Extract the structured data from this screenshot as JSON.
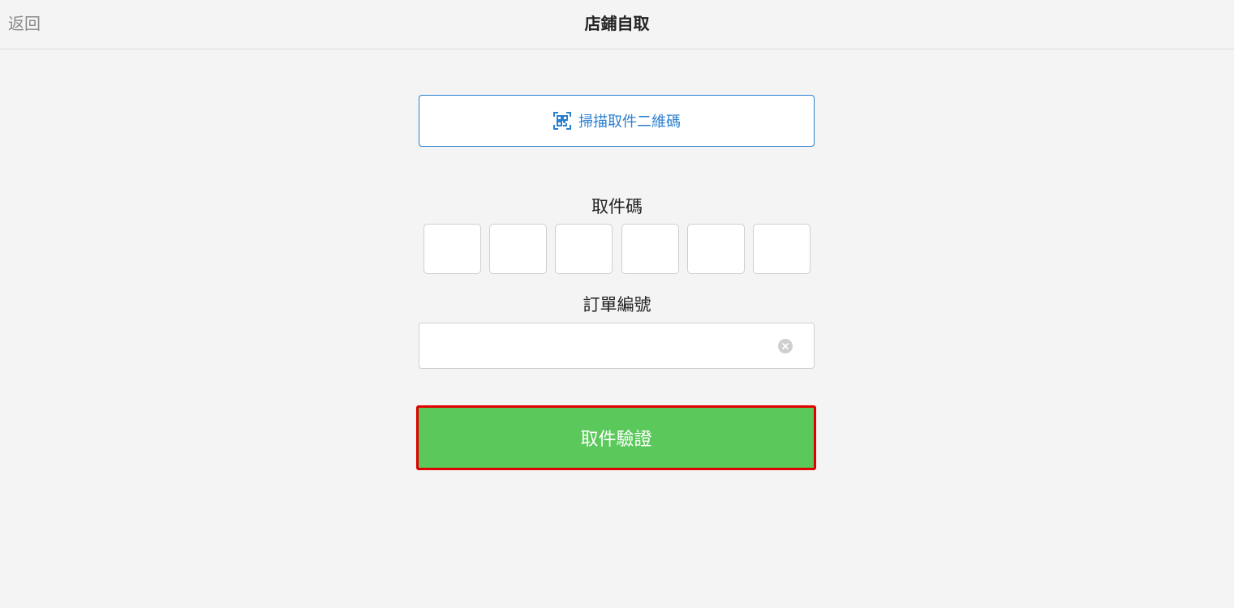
{
  "header": {
    "back_label": "返回",
    "title": "店鋪自取"
  },
  "scan": {
    "label": "掃描取件二維碼",
    "icon": "qr-scan-icon",
    "color": "#2b7fcf"
  },
  "pickup_code": {
    "label": "取件碼",
    "boxes": [
      "",
      "",
      "",
      "",
      "",
      ""
    ]
  },
  "order_number": {
    "label": "訂單編號",
    "value": "",
    "placeholder": ""
  },
  "verify": {
    "label": "取件驗證",
    "color": "#5ac85a",
    "highlight_color": "#e00000"
  }
}
